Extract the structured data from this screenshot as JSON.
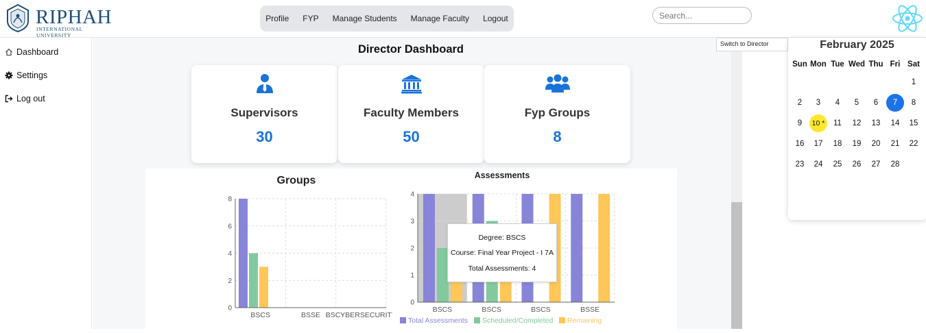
{
  "brand": {
    "name": "RIPHAH",
    "subtitle": "INTERNATIONAL UNIVERSITY"
  },
  "nav": {
    "items": [
      "Profile",
      "FYP",
      "Manage Students",
      "Manage Faculty",
      "Logout"
    ]
  },
  "search": {
    "placeholder": "Search..."
  },
  "sidebar": {
    "items": [
      {
        "label": "Dashboard",
        "icon": "home-icon"
      },
      {
        "label": "Settings",
        "icon": "gear-icon"
      },
      {
        "label": "Log out",
        "icon": "logout-icon"
      }
    ]
  },
  "dashboard": {
    "title": "Director Dashboard",
    "cards": [
      {
        "label": "Supervisors",
        "value": "30",
        "icon": "user-tie-icon"
      },
      {
        "label": "Faculty Members",
        "value": "50",
        "icon": "university-icon"
      },
      {
        "label": "Fyp Groups",
        "value": "8",
        "icon": "users-icon"
      }
    ]
  },
  "switch_role": {
    "label": "Switch to Director"
  },
  "calendar": {
    "title": "February 2025",
    "weekdays": [
      "Sun",
      "Mon",
      "Tue",
      "Wed",
      "Thu",
      "Fri",
      "Sat"
    ],
    "first_weekday": 6,
    "days_in_month": 28,
    "selected_day": 7,
    "today_day": 10,
    "today_marker": "10 *",
    "selected_color": "#1a73e8",
    "today_color": "#fde72e"
  },
  "colors": {
    "accent": "#1a73d9",
    "total": "#8884d8",
    "scheduled": "#82ca9d",
    "remaining": "#ffc658"
  },
  "chart_data": [
    {
      "type": "bar",
      "title": "Groups",
      "categories": [
        "BSCS",
        "BSSE",
        "BSCYBERSECURITY"
      ],
      "series": [
        {
          "values": [
            8,
            0,
            0
          ],
          "color": "#8884d8"
        },
        {
          "values": [
            4,
            0,
            0
          ],
          "color": "#82ca9d"
        },
        {
          "values": [
            3,
            0,
            0
          ],
          "color": "#ffc658"
        }
      ],
      "yticks": [
        0,
        2,
        4,
        6,
        8
      ],
      "ylim": [
        0,
        8
      ],
      "grid": true
    },
    {
      "type": "bar",
      "title": "Assessments",
      "categories": [
        "BSCS",
        "BSCS",
        "BSCS",
        "BSSE"
      ],
      "series": [
        {
          "name": "Total Assessments",
          "values": [
            4,
            4,
            4,
            4
          ],
          "color": "#8884d8"
        },
        {
          "name": "Scheduled/Completed",
          "values": [
            2,
            3,
            0,
            0
          ],
          "color": "#82ca9d"
        },
        {
          "name": "Remaining",
          "values": [
            2,
            1,
            4,
            4
          ],
          "color": "#ffc658"
        }
      ],
      "yticks": [
        0,
        1,
        2,
        3,
        4
      ],
      "ylim": [
        0,
        4
      ],
      "grid": true,
      "legend": "bottom",
      "hovered_index": 0,
      "tooltip": {
        "degree": "Degree: BSCS",
        "course": "Course: Final Year Project - I 7A",
        "total": "Total Assessments: 4"
      }
    }
  ]
}
